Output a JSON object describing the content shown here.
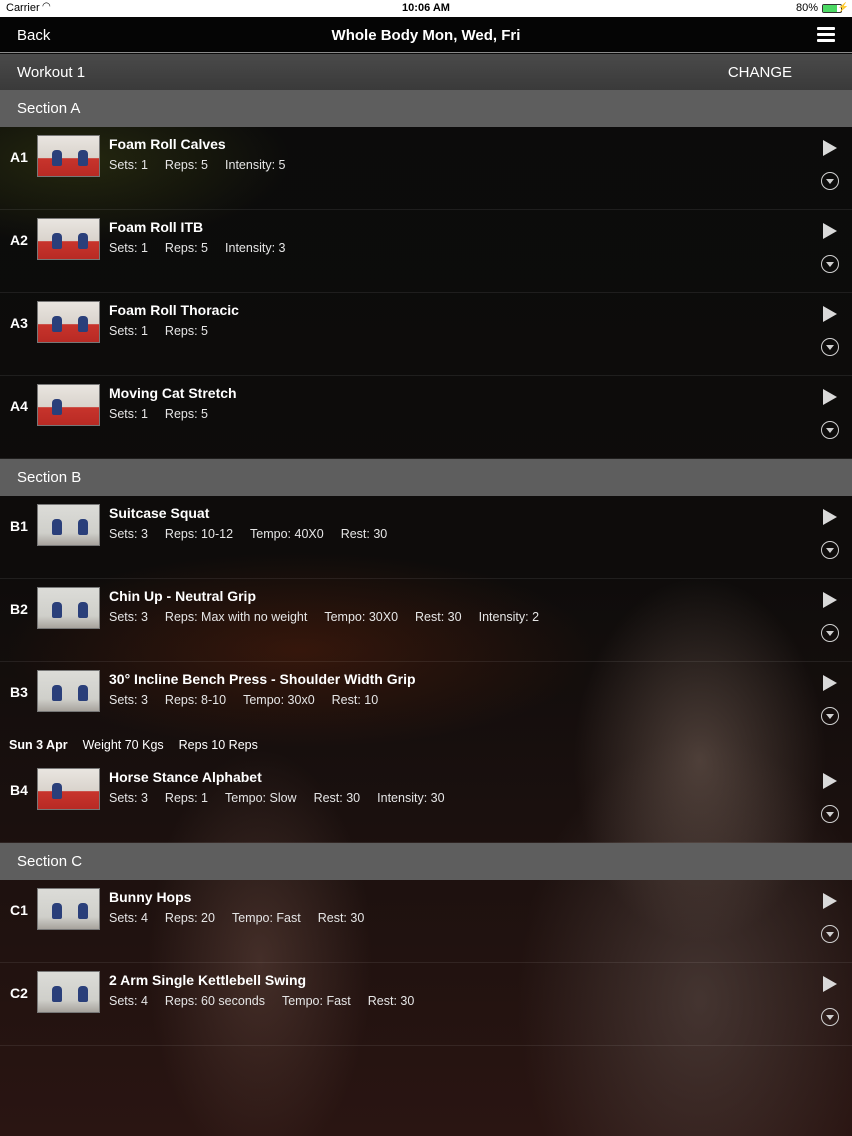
{
  "status_bar": {
    "carrier": "Carrier",
    "time": "10:06 AM",
    "battery": "80%"
  },
  "nav": {
    "back_label": "Back",
    "title": "Whole Body Mon, Wed, Fri"
  },
  "workout": {
    "label": "Workout 1",
    "change_label": "CHANGE"
  },
  "sections": [
    {
      "title": "Section A",
      "exercises": [
        {
          "code": "A1",
          "name": "Foam Roll Calves",
          "stats": [
            "Sets: 1",
            "Reps: 5",
            "Intensity: 5"
          ]
        },
        {
          "code": "A2",
          "name": "Foam Roll ITB",
          "stats": [
            "Sets: 1",
            "Reps: 5",
            "Intensity: 3"
          ]
        },
        {
          "code": "A3",
          "name": "Foam Roll Thoracic",
          "stats": [
            "Sets: 1",
            "Reps: 5"
          ]
        },
        {
          "code": "A4",
          "name": "Moving Cat Stretch",
          "stats": [
            "Sets: 1",
            "Reps: 5"
          ]
        }
      ]
    },
    {
      "title": "Section B",
      "exercises": [
        {
          "code": "B1",
          "name": "Suitcase Squat",
          "stats": [
            "Sets: 3",
            "Reps: 10-12",
            "Tempo: 40X0",
            "Rest: 30"
          ]
        },
        {
          "code": "B2",
          "name": "Chin Up - Neutral Grip",
          "stats": [
            "Sets: 3",
            "Reps: Max with no weight",
            "Tempo: 30X0",
            "Rest: 30",
            "Intensity: 2"
          ]
        },
        {
          "code": "B3",
          "name": "30° Incline Bench Press - Shoulder Width Grip",
          "stats": [
            "Sets: 3",
            "Reps: 8-10",
            "Tempo: 30x0",
            "Rest: 10"
          ]
        },
        {
          "code": "B4",
          "name": "Horse Stance Alphabet",
          "stats": [
            "Sets: 3",
            "Reps: 1",
            "Tempo: Slow",
            "Rest: 30",
            "Intensity: 30"
          ]
        }
      ]
    },
    {
      "title": "Section C",
      "exercises": [
        {
          "code": "C1",
          "name": "Bunny Hops",
          "stats": [
            "Sets: 4",
            "Reps: 20",
            "Tempo: Fast",
            "Rest: 30"
          ]
        },
        {
          "code": "C2",
          "name": "2 Arm Single Kettlebell Swing",
          "stats": [
            "Sets: 4",
            "Reps: 60 seconds",
            "Tempo: Fast",
            "Rest: 30"
          ]
        }
      ]
    }
  ],
  "history": {
    "date": "Sun 3 Apr",
    "weight": "Weight 70 Kgs",
    "reps": "Reps 10 Reps"
  },
  "icons": {
    "play": "play-icon",
    "expand": "chevron-down-circle-icon",
    "menu": "hamburger-menu-icon"
  }
}
